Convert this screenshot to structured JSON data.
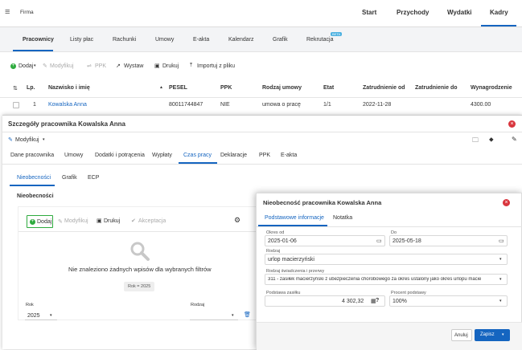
{
  "topnav": {
    "menu_icon": "menu-icon",
    "firma": "Firma",
    "items": [
      "Start",
      "Przychody",
      "Wydatki",
      "Kadry"
    ],
    "active": "Kadry"
  },
  "subtabs": {
    "items": [
      "Pracownicy",
      "Listy płac",
      "Rachunki",
      "Umowy",
      "E-akta",
      "Kalendarz",
      "Grafik",
      "Rekrutacja"
    ],
    "active": "Pracownicy",
    "badge": "BETA"
  },
  "toolbar": {
    "dodaj": "Dodaj",
    "modyfikuj": "Modyfikuj",
    "ppk": "PPK",
    "wystaw": "Wystaw",
    "drukuj": "Drukuj",
    "importuj": "Importuj z pliku"
  },
  "table": {
    "headers": [
      "Lp.",
      "Nazwisko i imię",
      "PESEL",
      "PPK",
      "Rodzaj umowy",
      "Etat",
      "Zatrudnienie od",
      "Zatrudnienie do",
      "Wynagrodzenie"
    ],
    "row": {
      "lp": "1",
      "name": "Kowalska Anna",
      "pesel": "80011744847",
      "ppk": "NIE",
      "umowa": "umowa o pracę",
      "etat": "1/1",
      "od": "2022-11-28",
      "do": "",
      "wyn": "4300.00"
    }
  },
  "details": {
    "title": "Szczegóły pracownika Kowalska Anna",
    "modyfikuj": "Modyfikuj",
    "tabs": [
      "Dane pracownika",
      "Umowy",
      "Dodatki i potrącenia",
      "Wypłaty",
      "Czas pracy",
      "Deklaracje",
      "PPK",
      "E-akta"
    ],
    "active_tab": "Czas pracy",
    "subtabs": [
      "Nieobecności",
      "Grafik",
      "ECP"
    ],
    "active_subtab": "Nieobecności",
    "section_title": "Nieobecności",
    "inner_toolbar": {
      "dodaj": "Dodaj",
      "modyfikuj": "Modyfikuj",
      "drukuj": "Drukuj",
      "akceptacja": "Akceptacja"
    },
    "empty_text": "Nie znaleziono żadnych wpisów dla wybranych filtrów",
    "filter_chip": "Rok = 2025",
    "rok_label": "Rok",
    "rok_value": "2025",
    "rodzaj_label": "Rodzaj"
  },
  "absence": {
    "title": "Nieobecność pracownika Kowalska Anna",
    "tabs": [
      "Podstawowe informacje",
      "Notatka"
    ],
    "active_tab": "Podstawowe informacje",
    "okres_od_label": "Okres od",
    "okres_od": "2025-01-06",
    "do_label": "Do",
    "do": "2025-05-18",
    "rodzaj_label": "Rodzaj",
    "rodzaj": "urlop macierzyński",
    "rodzaj_swiadczenia_label": "Rodzaj świadczenia i przerwy",
    "rodzaj_swiadczenia": "311 - zasiłek macierzyński z ubezpieczenia chorobowego za okres ustalony jako okres urlopu macie",
    "podstawa_label": "Podstawa zasiłku",
    "podstawa": "4 302,32",
    "procent_label": "Procent podstawy",
    "procent": "100%",
    "anuluj": "Anuluj",
    "zapisz": "Zapisz"
  },
  "colors": {
    "accent": "#1565c0",
    "green": "#2eab3e",
    "close": "#d9363e"
  }
}
